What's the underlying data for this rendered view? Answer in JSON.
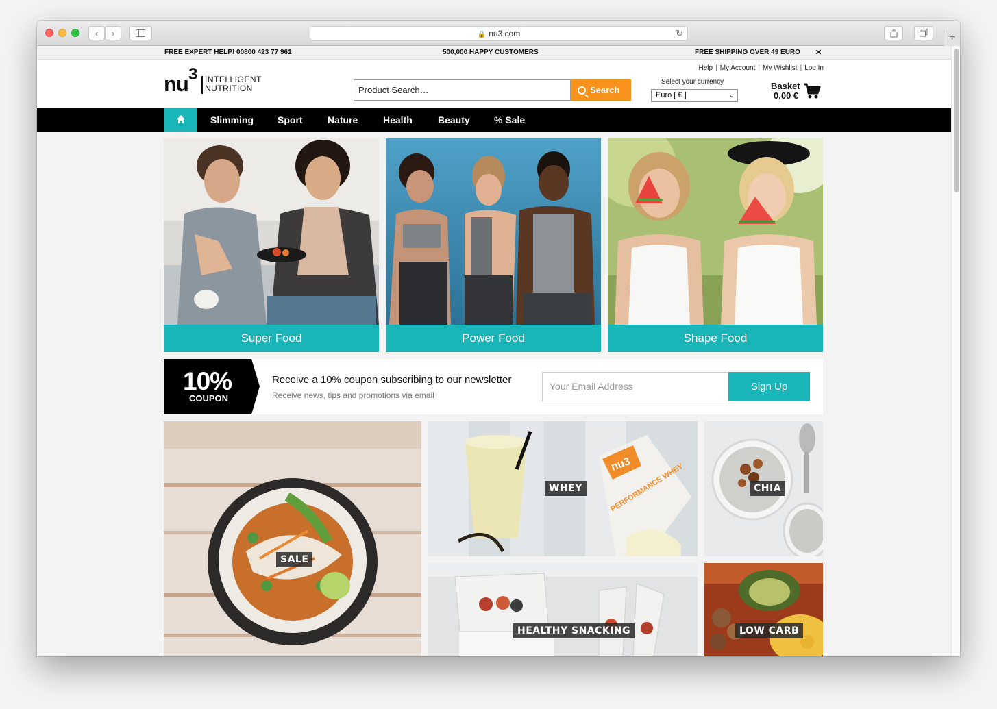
{
  "browser": {
    "url": "nu3.com",
    "colors": {
      "accent": "#19b5b8",
      "search": "#f7931d",
      "nav": "#000000"
    }
  },
  "topbar": {
    "hotline": "FREE EXPERT HELP! 00800 423 77 961",
    "customers": "500,000 HAPPY CUSTOMERS",
    "shipping": "FREE SHIPPING OVER 49 EURO",
    "close": "✕"
  },
  "header": {
    "logo_nu": "nu",
    "logo_3": "3",
    "logo_line1": "INTELLIGENT",
    "logo_line2": "NUTRITION",
    "search_placeholder": "Product Search…",
    "search_button": "Search",
    "links": [
      "Help",
      "My Account",
      "My Wishlist",
      "Log In"
    ],
    "currency_label": "Select your currency",
    "currency_value": "Euro [ € ]",
    "basket_label": "Basket",
    "basket_value": "0,00 €"
  },
  "nav": {
    "items": [
      "Slimming",
      "Sport",
      "Nature",
      "Health",
      "Beauty",
      "% Sale"
    ]
  },
  "tiles": [
    {
      "label": "Super Food",
      "icon": "couple-eating-photo"
    },
    {
      "label": "Power Food",
      "icon": "fitness-group-photo"
    },
    {
      "label": "Shape Food",
      "icon": "watermelon-friends-photo"
    }
  ],
  "newsletter": {
    "coupon_pct": "10%",
    "coupon_text": "COUPON",
    "title": "Receive a 10% coupon subscribing to our newsletter",
    "subtitle": "Receive news, tips and promotions via email",
    "email_placeholder": "Your Email Address",
    "signup": "Sign Up"
  },
  "categories": {
    "sale": "SALE",
    "whey": "WHEY",
    "chia": "CHIA",
    "snacking": "HEALTHY SNACKING",
    "lowcarb": "LOW CARB",
    "whey_pack_brand": "nu3",
    "whey_pack_text": "PERFORMANCE WHEY"
  }
}
